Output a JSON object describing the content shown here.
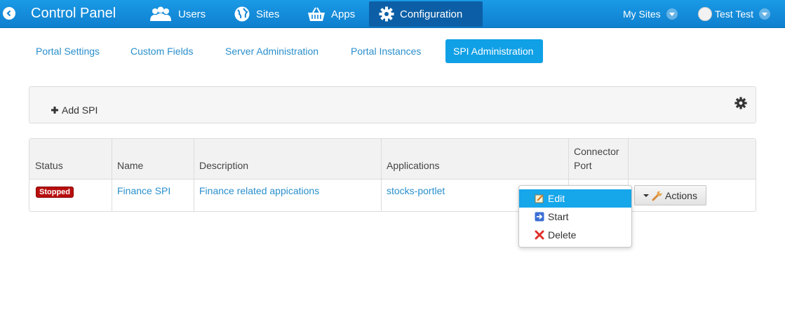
{
  "dock": {
    "title": "Control Panel",
    "nav": [
      {
        "label": "Users",
        "icon": "users-icon"
      },
      {
        "label": "Sites",
        "icon": "globe-icon"
      },
      {
        "label": "Apps",
        "icon": "basket-icon"
      },
      {
        "label": "Configuration",
        "icon": "gear-icon",
        "active": true
      }
    ],
    "my_sites": "My Sites",
    "user": "Test Test"
  },
  "tabs": [
    {
      "label": "Portal Settings"
    },
    {
      "label": "Custom Fields"
    },
    {
      "label": "Server Administration"
    },
    {
      "label": "Portal Instances"
    },
    {
      "label": "SPI Administration",
      "active": true
    }
  ],
  "toolbar": {
    "add_label": "Add SPI"
  },
  "table": {
    "headers": {
      "status": "Status",
      "name": "Name",
      "description": "Description",
      "applications": "Applications",
      "connector_1": "Connector",
      "connector_2": "Port"
    },
    "rows": [
      {
        "status": "Stopped",
        "name": "Finance SPI",
        "description": "Finance related appications",
        "applications": "stocks-portlet",
        "actions": "Actions"
      }
    ]
  },
  "menu": {
    "items": [
      {
        "label": "Edit",
        "icon": "edit-icon",
        "highlighted": true
      },
      {
        "label": "Start",
        "icon": "start-icon"
      },
      {
        "label": "Delete",
        "icon": "delete-icon"
      }
    ]
  },
  "colors": {
    "dock": "#1a9ae6",
    "accent": "#0fa0e6",
    "link": "#2a8fcc",
    "stopped": "#b80e0e"
  }
}
